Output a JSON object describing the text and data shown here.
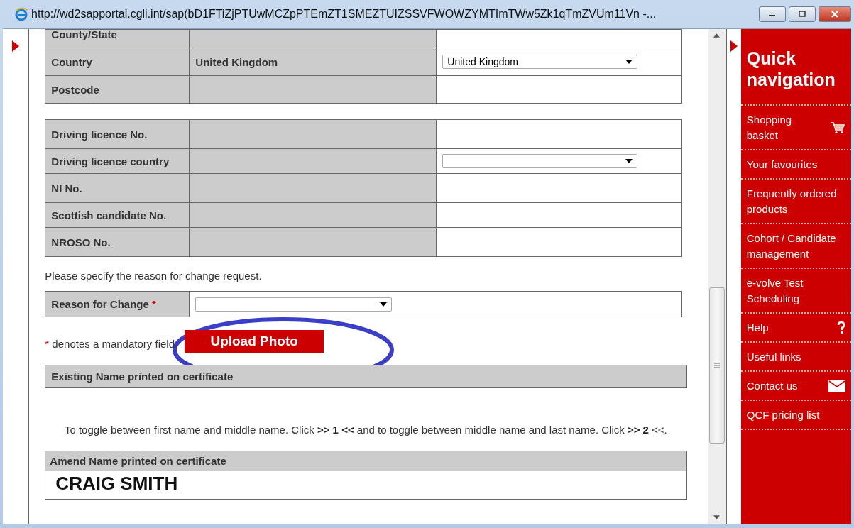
{
  "window": {
    "title": "http://wd2sapportal.cgli.int/sap(bD1FTiZjPTUwMCZpPTEmZT1SMEZTUIZSSVFWOWZYMTImTWw5Zk1qTmZVUm11Vn -..."
  },
  "address_table": [
    {
      "label": "County/State",
      "kind": "blank"
    },
    {
      "label": "Country",
      "value": "United Kingdom",
      "kind": "select",
      "selection": "United Kingdom"
    },
    {
      "label": "Postcode",
      "kind": "blank"
    }
  ],
  "id_table": [
    {
      "label": "Driving licence No.",
      "kind": "blank"
    },
    {
      "label": "Driving licence country",
      "kind": "select"
    },
    {
      "label": "NI No.",
      "kind": "blank"
    },
    {
      "label": "Scottish candidate No.",
      "kind": "blank"
    },
    {
      "label": "NROSO No.",
      "kind": "blank"
    }
  ],
  "reason_prompt": "Please specify the reason for change request.",
  "reason": {
    "label": "Reason for Change",
    "required_mark": "*"
  },
  "mandatory_note": {
    "mark": "*",
    "text": "denotes a mandatory field."
  },
  "upload_button": "Upload Photo",
  "existing_name_header": "Existing Name printed on certificate",
  "toggle_text": "To toggle between first name and middle name. Click **>> 1 <<** and to toggle between middle name and last name. Click **>> 2** <<.",
  "amend_name_header": "Amend Name printed on certificate",
  "amend_name_value": "CRAIG SMITH",
  "quick_nav": {
    "title": "Quick navigation",
    "items": [
      {
        "label": "Shopping basket",
        "kind": "basket"
      },
      {
        "label": "Your favourites",
        "kind": "link"
      },
      {
        "label": "Frequently ordered products",
        "kind": "link"
      },
      {
        "label": "Cohort / Candidate management",
        "kind": "link"
      },
      {
        "label": "e-volve Test Scheduling",
        "kind": "link"
      },
      {
        "label": "Help",
        "kind": "help"
      },
      {
        "label": "Useful links",
        "kind": "link"
      },
      {
        "label": "Contact us",
        "kind": "contact"
      },
      {
        "label": "QCF pricing list",
        "kind": "link"
      }
    ]
  }
}
